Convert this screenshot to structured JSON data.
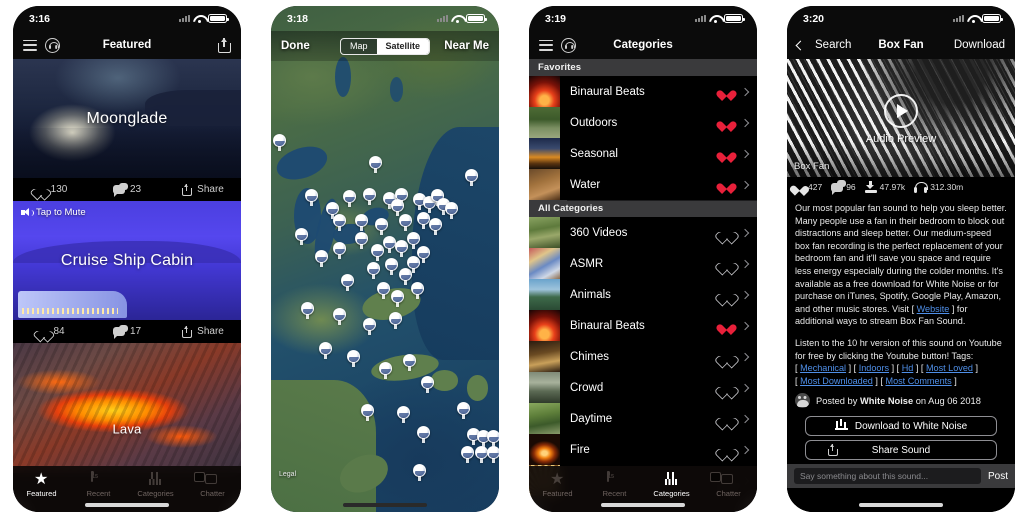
{
  "app": {
    "name": "White Noise"
  },
  "panels": {
    "featured": {
      "status": {
        "time": "3:16"
      },
      "nav": {
        "title": "Featured",
        "menu_icon": "hamburger-icon",
        "logo_icon": "headphones-logo-icon",
        "share_icon": "share-icon"
      },
      "cards": [
        {
          "title": "Moonglade",
          "likes": "130",
          "comments": "23",
          "share_label": "Share",
          "mute_label": "",
          "scene": "moonglade"
        },
        {
          "title": "Cruise Ship Cabin",
          "likes": "84",
          "comments": "17",
          "share_label": "Share",
          "mute_label": "Tap to Mute",
          "scene": "cruise"
        },
        {
          "title": "Lava",
          "likes": "",
          "comments": "",
          "share_label": "",
          "mute_label": "",
          "scene": "lava"
        }
      ],
      "tabs": [
        {
          "label": "Featured",
          "icon": "star-icon",
          "active": true
        },
        {
          "label": "Recent",
          "icon": "calendar-icon",
          "active": false
        },
        {
          "label": "Categories",
          "icon": "grid-icon",
          "active": false
        },
        {
          "label": "Chatter",
          "icon": "chat-bubbles-icon",
          "active": false
        }
      ]
    },
    "map": {
      "status": {
        "time": "3:18"
      },
      "nav": {
        "done_label": "Done",
        "near_me_label": "Near Me"
      },
      "segments": [
        {
          "label": "Map",
          "selected": false
        },
        {
          "label": "Satellite",
          "selected": true
        }
      ],
      "legal_label": "Legal"
    },
    "categories": {
      "status": {
        "time": "3:19"
      },
      "nav": {
        "title": "Categories",
        "menu_icon": "hamburger-icon",
        "logo_icon": "headphones-logo-icon"
      },
      "sections": [
        {
          "header": "Favorites",
          "rows": [
            {
              "name": "Binaural Beats",
              "favorited": true,
              "thumb": "binaural"
            },
            {
              "name": "Outdoors",
              "favorited": true,
              "thumb": "outdoors"
            },
            {
              "name": "Seasonal",
              "favorited": true,
              "thumb": "seasonal"
            },
            {
              "name": "Water",
              "favorited": true,
              "thumb": "water"
            }
          ]
        },
        {
          "header": "All Categories",
          "rows": [
            {
              "name": "360 Videos",
              "favorited": false,
              "thumb": "videos360"
            },
            {
              "name": "ASMR",
              "favorited": false,
              "thumb": "asmr"
            },
            {
              "name": "Animals",
              "favorited": false,
              "thumb": "animals"
            },
            {
              "name": "Binaural Beats",
              "favorited": true,
              "thumb": "binaural"
            },
            {
              "name": "Chimes",
              "favorited": false,
              "thumb": "chimes"
            },
            {
              "name": "Crowd",
              "favorited": false,
              "thumb": "crowd"
            },
            {
              "name": "Daytime",
              "favorited": false,
              "thumb": "daytime"
            },
            {
              "name": "Fire",
              "favorited": false,
              "thumb": "fire"
            }
          ]
        }
      ],
      "tabs": [
        {
          "label": "Featured",
          "icon": "star-icon",
          "active": false
        },
        {
          "label": "Recent",
          "icon": "calendar-icon",
          "active": false
        },
        {
          "label": "Categories",
          "icon": "grid-icon",
          "active": true
        },
        {
          "label": "Chatter",
          "icon": "chat-bubbles-icon",
          "active": false
        }
      ]
    },
    "detail": {
      "status": {
        "time": "3:20"
      },
      "nav": {
        "back_label": "Search",
        "title": "Box Fan",
        "download_label": "Download"
      },
      "hero": {
        "preview_label": "Audio Preview",
        "caption": "Box Fan",
        "play_icon": "play-icon"
      },
      "stats": [
        {
          "icon": "heart-icon",
          "value": "427"
        },
        {
          "icon": "comment-icon",
          "value": "96"
        },
        {
          "icon": "download-icon",
          "value": "47.97k"
        },
        {
          "icon": "headphones-icon",
          "value": "312.30m"
        }
      ],
      "description_part1": "Our most popular fan sound to help you sleep better. Many people use a fan in their bedroom to block out distractions and sleep better.  Our medium-speed box fan recording is the perfect replacement of your bedroom fan and it'll save you space and require less energy especially during the colder months.  It's available as a free download for White Noise or for purchase on iTunes, Spotify, Google Play, Amazon, and other music stores.  Visit [ ",
      "website_link": "Website",
      "description_part2": " ] for additional ways to stream Box Fan Sound.",
      "description_part3": "Listen to the 10 hr version of this sound on Youtube for free by clicking the Youtube button!  Tags:",
      "tags": [
        "Mechanical",
        "Indoors",
        "Hd",
        "Most Loved",
        "Most Downloaded",
        "Most Comments"
      ],
      "posted_prefix": "Posted by ",
      "posted_author": "White Noise",
      "posted_suffix": " on Aug 06 2018",
      "buttons": [
        {
          "label": "Download to White Noise",
          "icon": "equalizer-icon"
        },
        {
          "label": "Share Sound",
          "icon": "share-icon"
        }
      ],
      "comment": {
        "placeholder": "Say something about this sound...",
        "post_label": "Post"
      }
    }
  },
  "colors": {
    "accent_red": "#e8203a",
    "link_blue": "#4f8fe8",
    "section_gray": "#3a3a3c",
    "background": "#000000"
  }
}
